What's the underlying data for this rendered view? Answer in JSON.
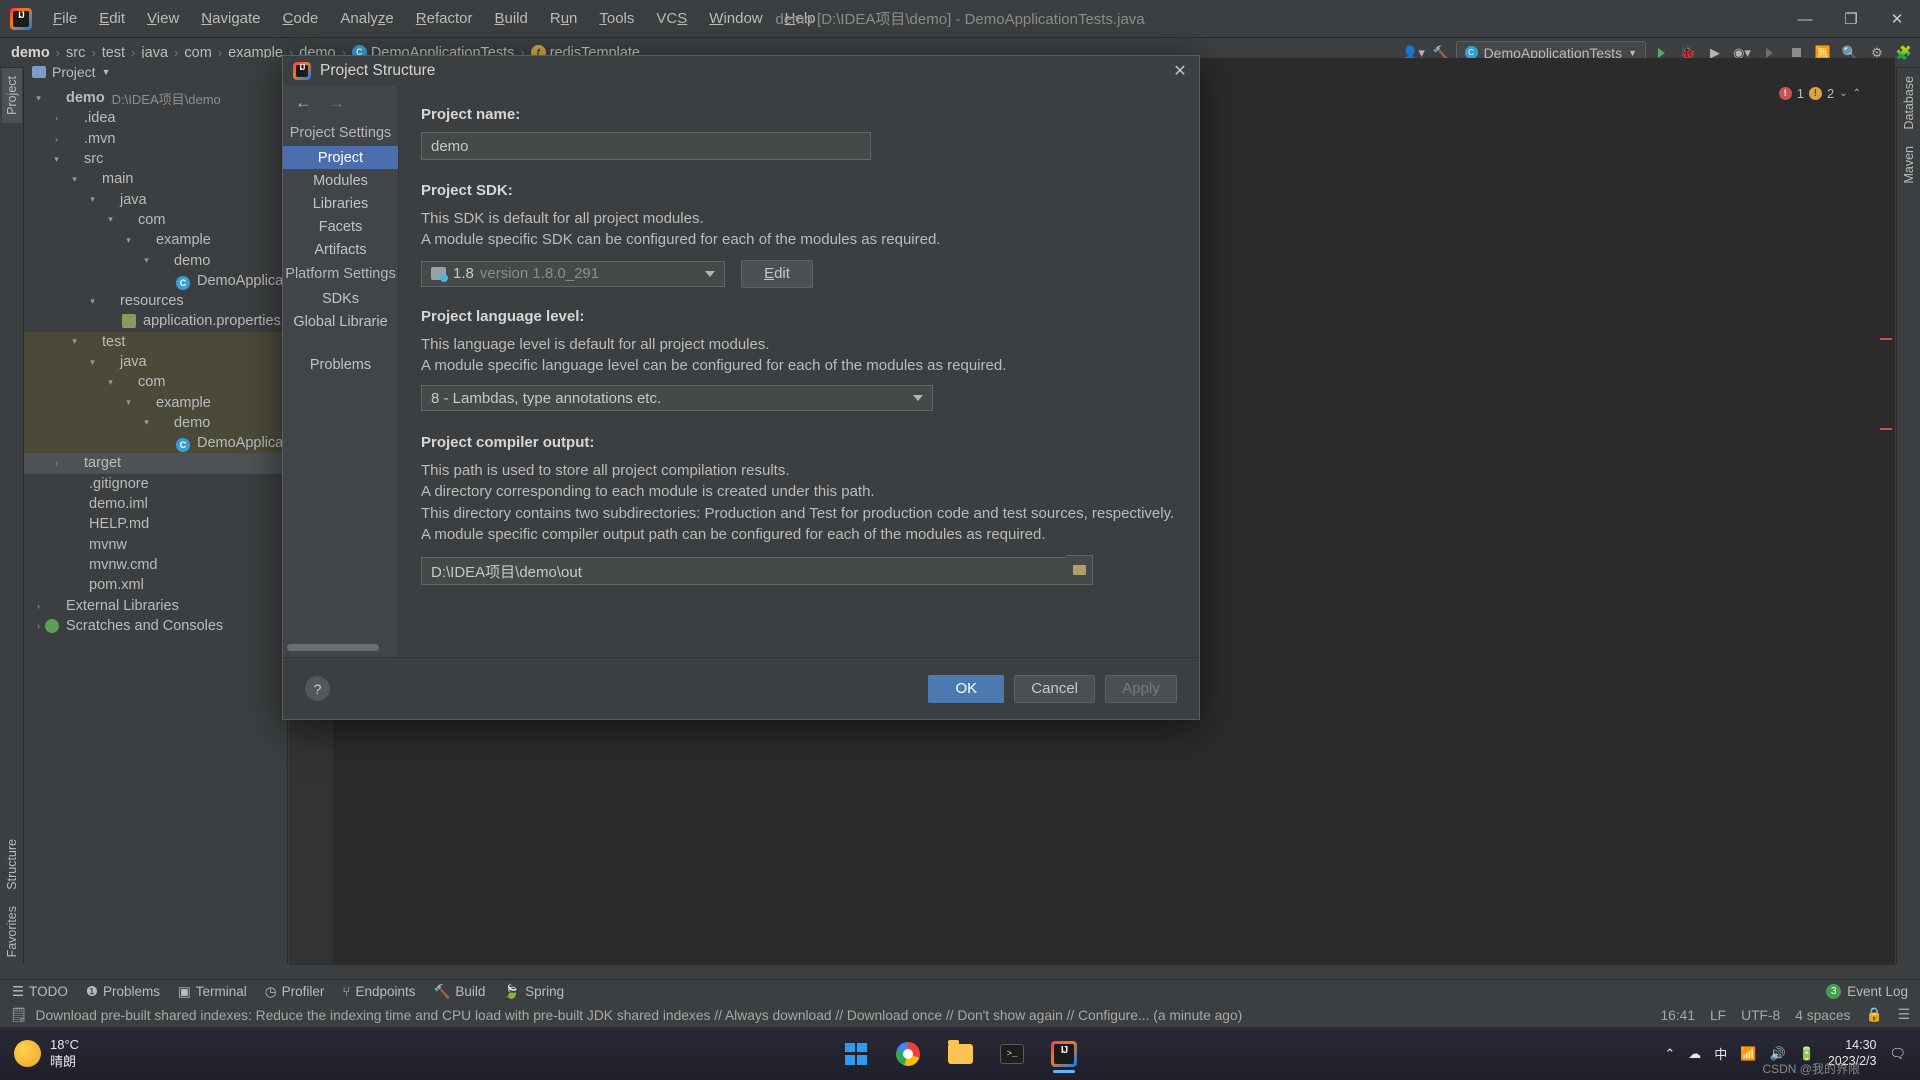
{
  "titlebar": {
    "app_icon": "intellij-logo-icon",
    "window_title": "demo [D:\\IDEA项目\\demo] - DemoApplicationTests.java",
    "menus": [
      {
        "label": "File",
        "mnemonic": "F"
      },
      {
        "label": "Edit",
        "mnemonic": "E"
      },
      {
        "label": "View",
        "mnemonic": "V"
      },
      {
        "label": "Navigate",
        "mnemonic": "N"
      },
      {
        "label": "Code",
        "mnemonic": "C"
      },
      {
        "label": "Analyze",
        "mnemonic": "z"
      },
      {
        "label": "Refactor",
        "mnemonic": "R"
      },
      {
        "label": "Build",
        "mnemonic": "B"
      },
      {
        "label": "Run",
        "mnemonic": "u"
      },
      {
        "label": "Tools",
        "mnemonic": "T"
      },
      {
        "label": "VCS",
        "mnemonic": "S"
      },
      {
        "label": "Window",
        "mnemonic": "W"
      },
      {
        "label": "Help",
        "mnemonic": "H"
      }
    ],
    "minimize": "—",
    "maximize": "❐",
    "close": "✕"
  },
  "navbar": {
    "breadcrumbs": [
      {
        "label": "demo",
        "icon": null
      },
      {
        "label": "src",
        "icon": null
      },
      {
        "label": "test",
        "icon": null
      },
      {
        "label": "java",
        "icon": null
      },
      {
        "label": "com",
        "icon": null
      },
      {
        "label": "example",
        "icon": null
      },
      {
        "label": "demo",
        "icon": null
      },
      {
        "label": "DemoApplicationTests",
        "icon": "class-icon"
      },
      {
        "label": "redisTemplate",
        "icon": "field-icon"
      }
    ],
    "run_config": "DemoApplicationTests",
    "separator": "›"
  },
  "left_strip": {
    "tabs": [
      "Project",
      "Structure",
      "Favorites"
    ]
  },
  "right_strip": {
    "tabs": [
      "Database",
      "Maven"
    ]
  },
  "project_window": {
    "title": "Project",
    "tree": [
      {
        "depth": 0,
        "label": "demo",
        "suffix": "D:\\IDEA项目\\demo",
        "arrow": "▾",
        "icon": "folder-blue-icon",
        "bold": true
      },
      {
        "depth": 1,
        "label": ".idea",
        "arrow": "▸",
        "icon": "folder-gray-icon"
      },
      {
        "depth": 1,
        "label": ".mvn",
        "arrow": "▸",
        "icon": "folder-gray-icon"
      },
      {
        "depth": 1,
        "label": "src",
        "arrow": "▾",
        "icon": "folder-gray-icon"
      },
      {
        "depth": 2,
        "label": "main",
        "arrow": "▾",
        "icon": "folder-gray-icon"
      },
      {
        "depth": 3,
        "label": "java",
        "arrow": "▾",
        "icon": "folder-blue-icon"
      },
      {
        "depth": 4,
        "label": "com",
        "arrow": "▾",
        "icon": "folder-gray-icon"
      },
      {
        "depth": 5,
        "label": "example",
        "arrow": "▾",
        "icon": "folder-gray-icon"
      },
      {
        "depth": 6,
        "label": "demo",
        "arrow": "▾",
        "icon": "folder-gray-icon"
      },
      {
        "depth": 7,
        "label": "DemoApplicati",
        "arrow": "",
        "icon": "class-icon"
      },
      {
        "depth": 3,
        "label": "resources",
        "arrow": "▾",
        "icon": "folder-orange-icon"
      },
      {
        "depth": 4,
        "label": "application.properties",
        "arrow": "",
        "icon": "properties-icon"
      },
      {
        "depth": 2,
        "label": "test",
        "arrow": "▾",
        "icon": "folder-gray-icon",
        "highlight": true
      },
      {
        "depth": 3,
        "label": "java",
        "arrow": "▾",
        "icon": "folder-green-icon",
        "highlight": true
      },
      {
        "depth": 4,
        "label": "com",
        "arrow": "▾",
        "icon": "folder-gray-icon",
        "highlight": true
      },
      {
        "depth": 5,
        "label": "example",
        "arrow": "▾",
        "icon": "folder-gray-icon",
        "highlight": true
      },
      {
        "depth": 6,
        "label": "demo",
        "arrow": "▾",
        "icon": "folder-gray-icon",
        "highlight": true
      },
      {
        "depth": 7,
        "label": "DemoApplicati",
        "arrow": "",
        "icon": "class-icon",
        "highlight": true
      },
      {
        "depth": 1,
        "label": "target",
        "arrow": "▸",
        "icon": "folder-orange-icon",
        "selected": true
      },
      {
        "depth": 1,
        "label": ".gitignore",
        "arrow": "",
        "icon": "gitignore-icon"
      },
      {
        "depth": 1,
        "label": "demo.iml",
        "arrow": "",
        "icon": "iml-icon"
      },
      {
        "depth": 1,
        "label": "HELP.md",
        "arrow": "",
        "icon": "markdown-icon"
      },
      {
        "depth": 1,
        "label": "mvnw",
        "arrow": "",
        "icon": "script-icon"
      },
      {
        "depth": 1,
        "label": "mvnw.cmd",
        "arrow": "",
        "icon": "cmd-icon"
      },
      {
        "depth": 1,
        "label": "pom.xml",
        "arrow": "",
        "icon": "maven-icon"
      },
      {
        "depth": 0,
        "label": "External Libraries",
        "arrow": "▸",
        "icon": "libraries-icon"
      },
      {
        "depth": 0,
        "label": "Scratches and Consoles",
        "arrow": "▸",
        "icon": "scratches-icon"
      }
    ]
  },
  "editor": {
    "error_count": "1",
    "warning_count": "2"
  },
  "dialog": {
    "title": "Project Structure",
    "icon": "intellij-logo-icon",
    "close": "✕",
    "nav_back": "←",
    "nav_forward": "→",
    "sidebar": [
      {
        "label": "Project Settings",
        "type": "header"
      },
      {
        "label": "Project",
        "type": "item",
        "selected": true
      },
      {
        "label": "Modules",
        "type": "item"
      },
      {
        "label": "Libraries",
        "type": "item"
      },
      {
        "label": "Facets",
        "type": "item"
      },
      {
        "label": "Artifacts",
        "type": "item"
      },
      {
        "label": "Platform Settings",
        "type": "header"
      },
      {
        "label": "SDKs",
        "type": "item"
      },
      {
        "label": "Global Librarie",
        "type": "item"
      },
      {
        "label": "Problems",
        "type": "item"
      }
    ],
    "project_name_label": "Project name:",
    "project_name_value": "demo",
    "sdk_label": "Project SDK:",
    "sdk_desc1": "This SDK is default for all project modules.",
    "sdk_desc2": "A module specific SDK can be configured for each of the modules as required.",
    "sdk_value": "1.8",
    "sdk_version": "version 1.8.0_291",
    "edit_button": "Edit",
    "edit_mnemonic": "E",
    "lang_label": "Project language level:",
    "lang_desc1": "This language level is default for all project modules.",
    "lang_desc2": "A module specific language level can be configured for each of the modules as required.",
    "lang_value": "8 - Lambdas, type annotations etc.",
    "out_label": "Project compiler output:",
    "out_desc1": "This path is used to store all project compilation results.",
    "out_desc2": "A directory corresponding to each module is created under this path.",
    "out_desc3": "This directory contains two subdirectories: Production and Test for production code and test sources, respectively.",
    "out_desc4": "A module specific compiler output path can be configured for each of the modules as required.",
    "out_value": "D:\\IDEA项目\\demo\\out",
    "help_button": "?",
    "ok_button": "OK",
    "cancel_button": "Cancel",
    "apply_button": "Apply",
    "accent_color": "#4a7ab0",
    "selection_color": "#4b6eaf"
  },
  "tool_window_bar": {
    "items": [
      {
        "label": "TODO",
        "icon": "todo-icon"
      },
      {
        "label": "Problems",
        "icon": "problems-icon"
      },
      {
        "label": "Terminal",
        "icon": "terminal-icon"
      },
      {
        "label": "Profiler",
        "icon": "profiler-icon"
      },
      {
        "label": "Endpoints",
        "icon": "endpoints-icon"
      },
      {
        "label": "Build",
        "icon": "build-icon"
      },
      {
        "label": "Spring",
        "icon": "spring-icon"
      }
    ],
    "event_log": "Event Log",
    "event_count": "3"
  },
  "status_bar": {
    "message": "Download pre-built shared indexes: Reduce the indexing time and CPU load with pre-built JDK shared indexes // Always download // Download once // Don't show again // Configure... (a minute ago)",
    "time": "16:41",
    "line_sep": "LF",
    "encoding": "UTF-8",
    "indent": "4 spaces"
  },
  "taskbar": {
    "weather_temp": "18°C",
    "weather_desc": "晴朗",
    "apps": [
      {
        "name": "start-button",
        "icon": "windows-logo-icon"
      },
      {
        "name": "chrome",
        "icon": "chrome-icon"
      },
      {
        "name": "file-explorer",
        "icon": "folder-icon"
      },
      {
        "name": "terminal",
        "icon": "terminal-icon"
      },
      {
        "name": "intellij-idea",
        "icon": "intellij-logo-icon",
        "active": true
      }
    ],
    "ime": "中",
    "clock_time": "14:30",
    "clock_date": "2023/2/3",
    "watermark": "CSDN @我的界限"
  }
}
